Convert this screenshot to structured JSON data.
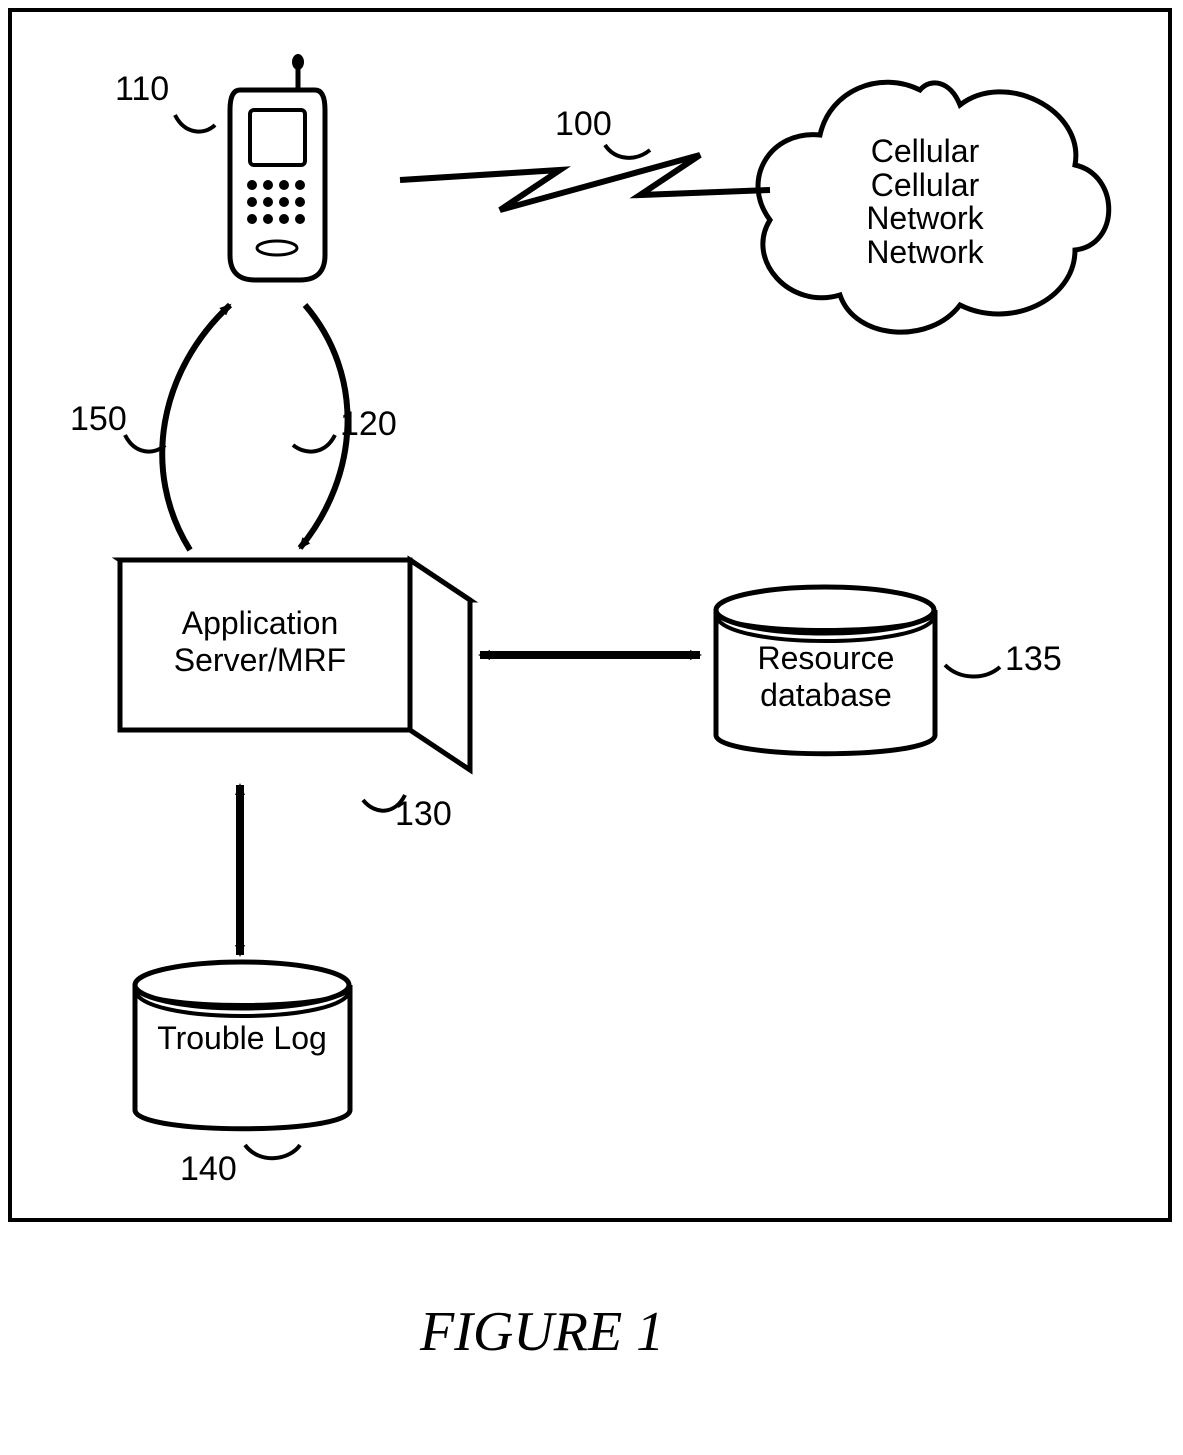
{
  "labels": {
    "l100": "100",
    "l110": "110",
    "l120": "120",
    "l130": "130",
    "l135": "135",
    "l140": "140",
    "l150": "150"
  },
  "nodes": {
    "appServer": "Application Server/MRF",
    "resourceDb": "Resource database",
    "troubleLog": "Trouble Log",
    "cloud": "Cellular Cellular Network Network"
  },
  "caption": "FIGURE 1"
}
